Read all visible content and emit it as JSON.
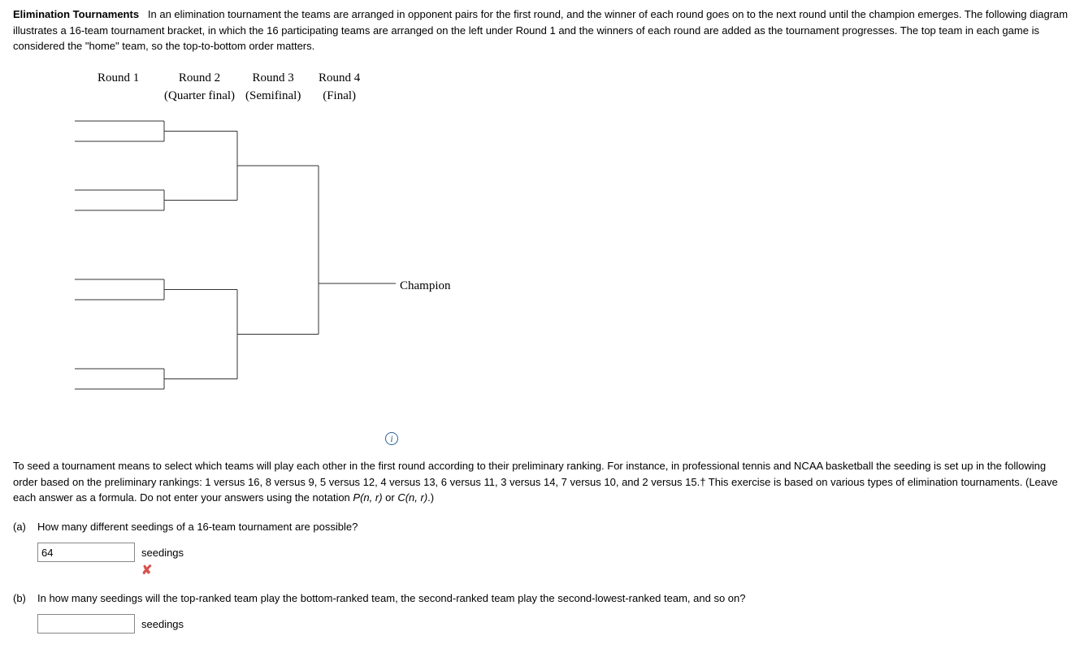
{
  "intro": {
    "title": "Elimination Tournaments",
    "text": "In an elimination tournament the teams are arranged in opponent pairs for the first round, and the winner of each round goes on to the next round until the champion emerges. The following diagram illustrates a 16-team tournament bracket, in which the 16 participating teams are arranged on the left under Round 1 and the winners of each round are added as the tournament progresses. The top team in each game is considered the \"home\" team, so the top-to-bottom order matters."
  },
  "rounds": {
    "r1": "Round 1",
    "r2": "Round 2",
    "r2_sub": "(Quarter final)",
    "r3": "Round 3",
    "r3_sub": "(Semifinal)",
    "r4": "Round 4",
    "r4_sub": "(Final)",
    "champion": "Champion"
  },
  "para2_pre": "To seed a tournament means to select which teams will play each other in the first round according to their preliminary ranking. For instance, in professional tennis and NCAA basketball the seeding is set up in the following order based on the preliminary rankings: 1 versus 16, 8 versus 9, 5 versus 12, 4 versus 13, 6 versus 11, 3 versus 14, 7 versus 10, and 2 versus 15.† This exercise is based on various types of elimination tournaments. (Leave each answer as a formula. Do not enter your answers using the notation ",
  "para2_pnr": "P(n, r)",
  "para2_or": " or ",
  "para2_cnr": "C(n, r)",
  "para2_post": ".)",
  "qa": {
    "letter": "(a)",
    "text": "How many different seedings of a 16-team tournament are possible?",
    "value": "64",
    "units": "seedings"
  },
  "qb": {
    "letter": "(b)",
    "text": "In how many seedings will the top-ranked team play the bottom-ranked team, the second-ranked team play the second-lowest-ranked team, and so on?",
    "value": "",
    "units": "seedings"
  }
}
